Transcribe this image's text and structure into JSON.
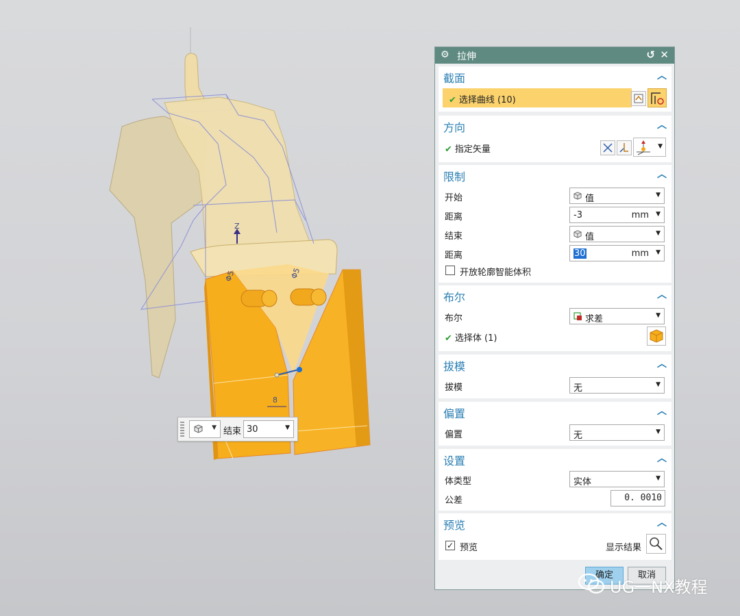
{
  "dialog": {
    "title": "拉伸",
    "title_icon": "gear-icon",
    "reset_icon": "reset-icon",
    "close_icon": "close-icon",
    "sections": {
      "section": {
        "title": "截面",
        "select_curve_label": "选择曲线 (10)"
      },
      "direction": {
        "title": "方向",
        "specify_vector_label": "指定矢量"
      },
      "limits": {
        "title": "限制",
        "start_label": "开始",
        "start_value": "值",
        "start_distance_label": "距离",
        "start_distance_value": "-3",
        "start_distance_unit": "mm",
        "end_label": "结束",
        "end_value": "值",
        "end_distance_label": "距离",
        "end_distance_value": "30",
        "end_distance_unit": "mm",
        "open_profile_label": "开放轮廓智能体积",
        "open_profile_checked": false
      },
      "boolean": {
        "title": "布尔",
        "boolean_label": "布尔",
        "boolean_value": "求差",
        "select_body_label": "选择体 (1)"
      },
      "draft": {
        "title": "拔模",
        "draft_label": "拔模",
        "draft_value": "无"
      },
      "offset": {
        "title": "偏置",
        "offset_label": "偏置",
        "offset_value": "无"
      },
      "settings": {
        "title": "设置",
        "body_type_label": "体类型",
        "body_type_value": "实体",
        "tolerance_label": "公差",
        "tolerance_value": "0. 0010"
      },
      "preview": {
        "title": "预览",
        "preview_label": "预览",
        "preview_checked": true,
        "show_result_label": "显示结果"
      }
    },
    "ok_label": "确定",
    "cancel_label": "取消"
  },
  "onscreen_input": {
    "end_label": "结束",
    "end_value": "30"
  },
  "viewport": {
    "axis_label": "Z",
    "dim_left": "Φ5",
    "dim_right": "Φ5",
    "dim_bottom": "8"
  },
  "watermark": {
    "text": "UG一NX教程"
  },
  "colors": {
    "title_bar": "#5e8a81",
    "section_title": "#2a7fb3",
    "selection_highlight": "#fbd26c",
    "part_beige": "#f0dfae",
    "extrude_orange": "#f6ae1c",
    "check_green": "#2e9d34"
  }
}
